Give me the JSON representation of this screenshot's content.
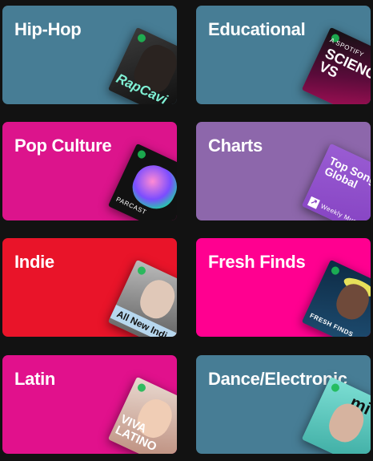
{
  "cards": [
    {
      "title": "Hip-Hop",
      "color": "#477d95",
      "art_text": "RapCavi"
    },
    {
      "title": "Educational",
      "color": "#477d95",
      "art_text": "SCIENCE VS",
      "art_sub": "A SPOTIFY"
    },
    {
      "title": "Pop Culture",
      "color": "#dc148c",
      "art_sub": "PARCAST"
    },
    {
      "title": "Charts",
      "color": "#8d67ab",
      "art_text": "Top Songs Global",
      "art_sub": "Weekly Mus"
    },
    {
      "title": "Indie",
      "color": "#e91429",
      "art_text": "All New Indi"
    },
    {
      "title": "Fresh Finds",
      "color": "#ff0090",
      "art_sub": "FRESH FINDS"
    },
    {
      "title": "Latin",
      "color": "#e1118c",
      "art_text": "VIVA LATINO"
    },
    {
      "title": "Dance/Electronic",
      "color": "#477d95",
      "art_text": "mi"
    }
  ]
}
